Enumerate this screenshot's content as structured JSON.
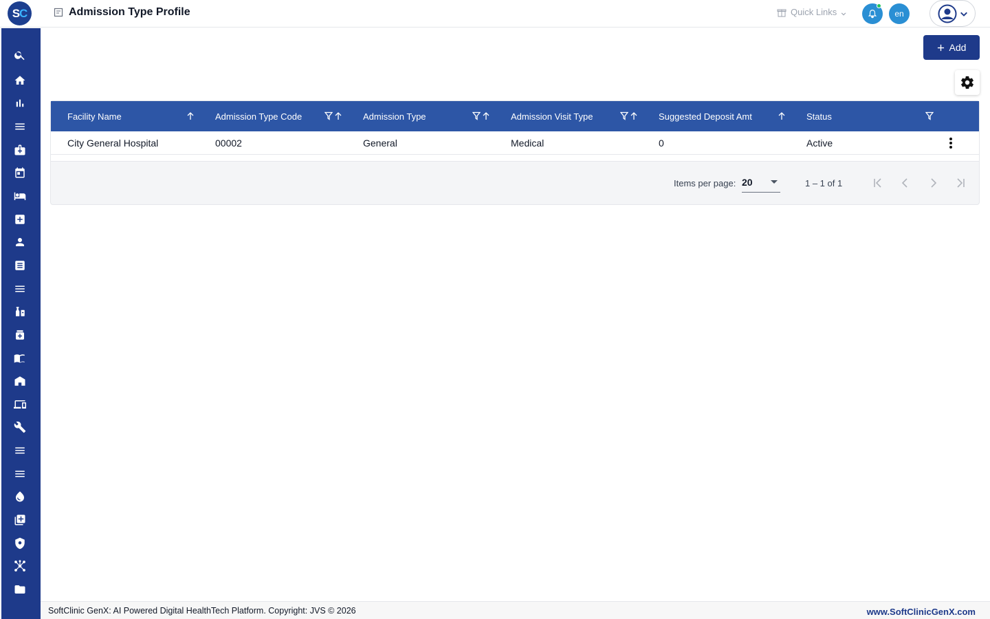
{
  "app": {
    "logo_text_s": "S",
    "logo_text_c": "C",
    "page_title": "Admission Type Profile"
  },
  "header": {
    "quick_links_label": "Quick Links",
    "language_label": "en",
    "notification_dot_color": "#22c55e"
  },
  "toolbar": {
    "add_label": "Add"
  },
  "sidebar": {
    "items": [
      {
        "icon": "search-icon"
      },
      {
        "icon": "home-icon"
      },
      {
        "icon": "bar-chart-icon"
      },
      {
        "icon": "menu-icon"
      },
      {
        "icon": "medical-bag-icon"
      },
      {
        "icon": "calendar-icon"
      },
      {
        "icon": "bed-icon"
      },
      {
        "icon": "plus-box-icon"
      },
      {
        "icon": "person-icon"
      },
      {
        "icon": "document-list-icon"
      },
      {
        "icon": "menu-icon"
      },
      {
        "icon": "pharmacy-icon"
      },
      {
        "icon": "medicine-box-icon"
      },
      {
        "icon": "book-icon"
      },
      {
        "icon": "building-icon"
      },
      {
        "icon": "devices-icon"
      },
      {
        "icon": "wrench-icon"
      },
      {
        "icon": "menu-icon"
      },
      {
        "icon": "menu-icon"
      },
      {
        "icon": "blood-drop-icon"
      },
      {
        "icon": "add-library-icon"
      },
      {
        "icon": "shield-icon"
      },
      {
        "icon": "network-icon"
      },
      {
        "icon": "folder-icon"
      }
    ]
  },
  "table": {
    "columns": [
      {
        "label": "Facility Name"
      },
      {
        "label": "Admission Type Code"
      },
      {
        "label": "Admission Type"
      },
      {
        "label": "Admission Visit Type"
      },
      {
        "label": "Suggested Deposit Amt"
      },
      {
        "label": "Status"
      }
    ],
    "rows": [
      {
        "facility_name": "City General Hospital",
        "admission_type_code": "00002",
        "admission_type": "General",
        "admission_visit_type": "Medical",
        "suggested_deposit_amt": "0",
        "status": "Active"
      }
    ]
  },
  "paginator": {
    "items_per_page_label": "Items per page:",
    "items_per_page_value": "20",
    "range_label": "1 – 1 of 1"
  },
  "footer": {
    "copyright": "SoftClinic GenX: AI Powered Digital HealthTech Platform. Copyright: JVS © 2026",
    "website": "www.SoftClinicGenX.com"
  },
  "colors": {
    "sidebar": "#1e3a8a",
    "table_header": "#2d56a6",
    "accent": "#2a8fd4"
  }
}
